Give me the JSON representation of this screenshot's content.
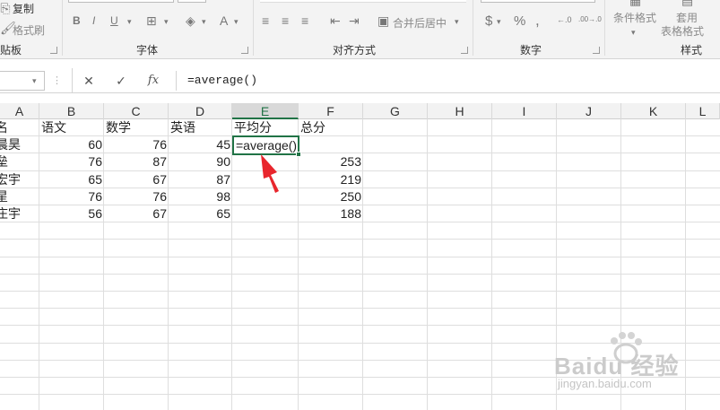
{
  "ribbon": {
    "clipboard": {
      "copy_label": "复制",
      "format_painter_label": "格式刷",
      "group_label": "粘贴板"
    },
    "font": {
      "bold": "B",
      "italic": "I",
      "underline": "U",
      "font_color": "A",
      "group_label": "字体"
    },
    "alignment": {
      "merge_label": "合并后居中",
      "group_label": "对齐方式"
    },
    "number": {
      "currency": "$",
      "percent": "%",
      "comma": ",",
      "inc_decimal": "←.0",
      "dec_decimal": ".00→.0",
      "group_label": "数字"
    },
    "styles": {
      "conditional_label": "条件格式",
      "table_format_label_1": "套用",
      "table_format_label_2": "表格格式",
      "group_label": "样式"
    }
  },
  "formula_bar": {
    "cancel": "✕",
    "confirm": "✓",
    "fx": "fx",
    "value": "=average()"
  },
  "columns": [
    "A",
    "B",
    "C",
    "D",
    "E",
    "F",
    "G",
    "H",
    "I",
    "J",
    "K",
    "L"
  ],
  "selected_column": "E",
  "rows": [
    [
      "名",
      "语文",
      "数学",
      "英语",
      "平均分",
      "总分"
    ],
    [
      "晨昊",
      "60",
      "76",
      "45",
      "=average()",
      ""
    ],
    [
      "垒",
      "76",
      "87",
      "90",
      "",
      "253"
    ],
    [
      "宏宇",
      "65",
      "67",
      "87",
      "",
      "219"
    ],
    [
      "星",
      "76",
      "76",
      "98",
      "",
      "250"
    ],
    [
      "庄宇",
      "56",
      "67",
      "65",
      "",
      "188"
    ]
  ],
  "active_cell_text": "=average()",
  "watermark": {
    "brand": "Baidu 经验",
    "url": "jingyan.baidu.com"
  },
  "colors": {
    "accent": "#217346",
    "arrow": "#e8262d"
  }
}
